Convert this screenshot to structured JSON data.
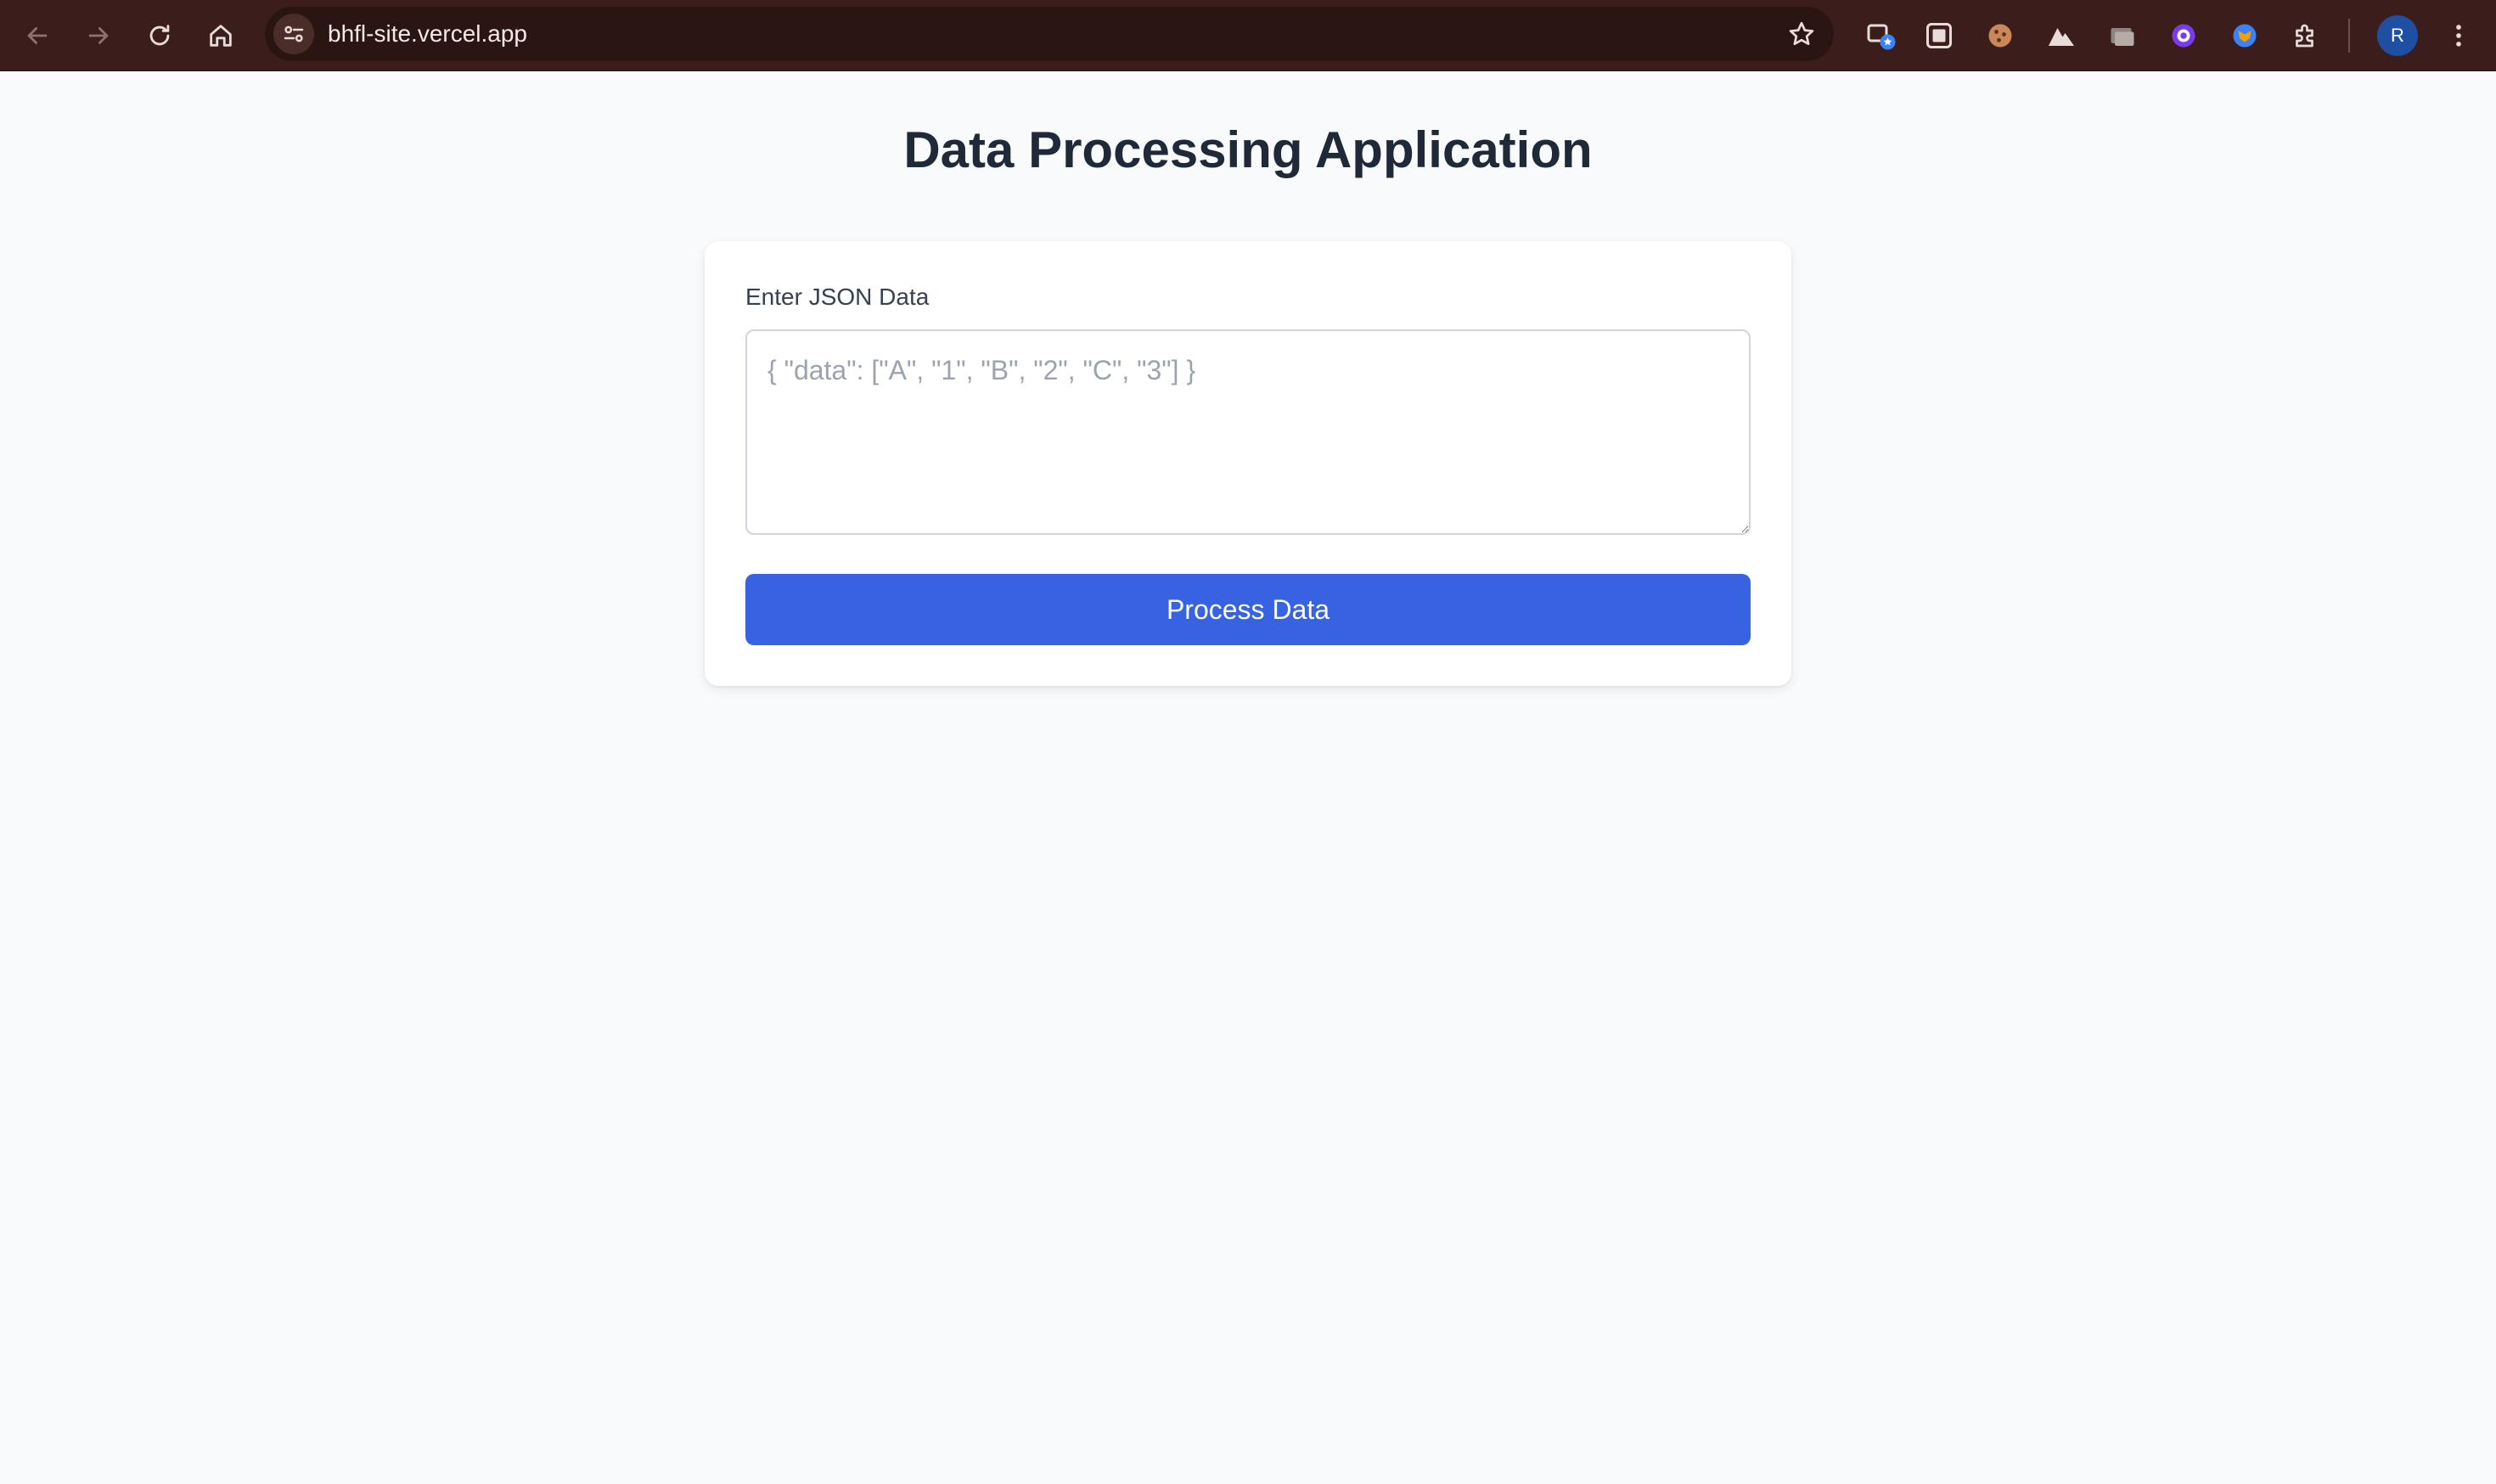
{
  "browser": {
    "url": "bhfl-site.vercel.app",
    "profile_initial": "R",
    "icons": {
      "back": "arrow-left-icon",
      "forward": "arrow-right-icon",
      "reload": "reload-icon",
      "home": "home-icon",
      "site_info": "tune-icon",
      "bookmark": "star-icon",
      "menu": "kebab-menu-icon"
    },
    "extensions": [
      "tab-star-extension-icon",
      "screen-capture-extension-icon",
      "cookie-extension-icon",
      "mountain-extension-icon",
      "window-extension-icon",
      "purple-badge-extension-icon",
      "fox-extension-icon",
      "puzzle-extensions-icon"
    ],
    "colors": {
      "toolbar": "#3b1e1b",
      "omnibox": "#2b1513",
      "avatar": "#1f4fa3"
    }
  },
  "page": {
    "title": "Data Processing Application",
    "form": {
      "label": "Enter JSON Data",
      "input_value": "",
      "input_placeholder": "{ \"data\": [\"A\", \"1\", \"B\", \"2\", \"C\", \"3\"] }",
      "submit_label": "Process Data"
    },
    "colors": {
      "background": "#f8fafc",
      "title": "#1f2937",
      "button": "#3763e3"
    }
  }
}
